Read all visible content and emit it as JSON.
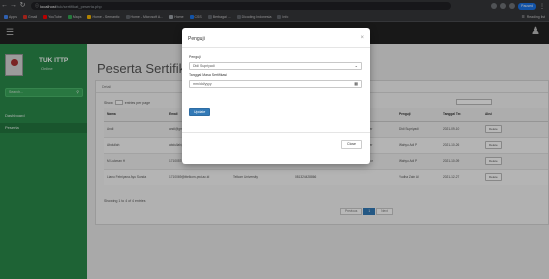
{
  "browser": {
    "url_host": "localhost",
    "url_path": "/tuk/sertifikat_peserta.php",
    "bookmarks": [
      {
        "label": "Apps",
        "color": "#4285f4"
      },
      {
        "label": "Gmail",
        "color": "#d93025"
      },
      {
        "label": "YouTube",
        "color": "#ff0000"
      },
      {
        "label": "Maps",
        "color": "#34a853"
      },
      {
        "label": "Home - Semantic",
        "color": "#f4b400"
      },
      {
        "label": "Home - Microsoft A...",
        "color": "#5f6368"
      },
      {
        "label": "Home",
        "color": "#9aa0a6"
      },
      {
        "label": "CSS",
        "color": "#1a73e8"
      },
      {
        "label": "Berbagai ...",
        "color": "#5f6368"
      },
      {
        "label": "Dicoding Indonesia",
        "color": "#5f6368"
      },
      {
        "label": "Info",
        "color": "#5f6368"
      }
    ],
    "bookmark_right": "Reading list",
    "profile_label": "Paused"
  },
  "sidebar": {
    "brand_name": "TUK ITTP",
    "brand_sub": "Online",
    "search_placeholder": "Search...",
    "items": [
      {
        "label": "Dashboard"
      },
      {
        "label": "Peserta"
      }
    ]
  },
  "main": {
    "page_title": "Peserta Sertifikat",
    "panel_head": "Detail",
    "show_prefix": "Show",
    "show_suffix": "entries per page",
    "search_label": "Search:",
    "columns": [
      "Nama",
      "Email",
      "Instansi",
      "No. Telp",
      "Sertifikasi",
      "Penguji",
      "Tanggal Ter.",
      "Aksi"
    ],
    "rows": [
      {
        "nama": "Andi",
        "email": "andi@gmail.com",
        "instansi": "Telkom University",
        "telp": "082113546772",
        "sertifikasi": "Junior Web Developer",
        "penguji": "Didi Supriyadi",
        "tanggal": "2021-09-10",
        "aksi": "Delete"
      },
      {
        "nama": "Abdullah",
        "email": "abdullah@gmail.com",
        "instansi": "Telkom University",
        "telp": "082198776612",
        "sertifikasi": "Junior Web Developer",
        "penguji": "Wahyu Adi P",
        "tanggal": "2021-10-26",
        "aksi": "Delete"
      },
      {
        "nama": "M Lukman H",
        "email": "1710057@ittelkom-pwt.ac.id",
        "instansi": "Telkom University",
        "telp": "081324428867",
        "sertifikasi": "ICT Project Supervisor",
        "penguji": "Wahyu Adi P",
        "tanggal": "2021-10-09",
        "aksi": "Delete"
      },
      {
        "nama": "Lianu Febriyana Ayu Sunda",
        "email": "1710069@ittelkom-pwt.ac.id",
        "instansi": "Telkom University",
        "telp": "081324428866",
        "sertifikasi": "",
        "penguji": "Yudha Zain Al",
        "tanggal": "2021-12-27",
        "aksi": "Delete"
      }
    ],
    "info": "Showing 1 to 4 of 4 entries",
    "pager": {
      "prev": "Previous",
      "current": "1",
      "next": "Next"
    }
  },
  "modal": {
    "title": "Penguji",
    "close_glyph": "×",
    "penguji_label": "Penguji",
    "penguji_value": "Didi Supriyadi",
    "tanggal_label": "Tanggal Masa Sertifikasi",
    "tanggal_value": "mm/dd/yyyy",
    "update_button": "Update",
    "close_button": "Close"
  }
}
